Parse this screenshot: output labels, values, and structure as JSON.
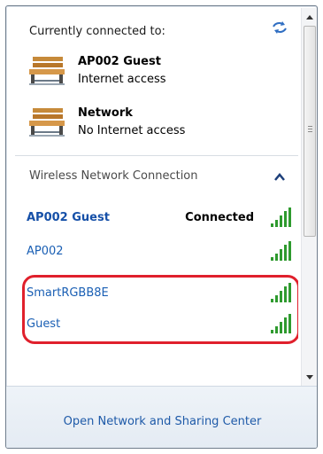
{
  "header": {
    "title": "Currently connected to:",
    "refresh_icon": "refresh-network-icon"
  },
  "connections": [
    {
      "name": "AP002 Guest",
      "status": "Internet access",
      "icon": "bench-network-icon"
    },
    {
      "name": "Network",
      "status": "No Internet access",
      "icon": "bench-network-icon"
    }
  ],
  "wireless": {
    "section_title": "Wireless Network Connection",
    "collapse_icon": "chevron-up-icon",
    "networks": [
      {
        "name": "AP002 Guest",
        "status": "Connected",
        "signal": "signal-bars-icon"
      },
      {
        "name": "AP002",
        "status": "",
        "signal": "signal-bars-icon"
      },
      {
        "name": "SmartRGBB8E",
        "status": "",
        "signal": "signal-bars-icon"
      },
      {
        "name": "Guest",
        "status": "",
        "signal": "signal-bars-icon"
      }
    ]
  },
  "footer": {
    "link": "Open Network and Sharing Center"
  },
  "colors": {
    "link_blue": "#1a5fb4",
    "highlight_red": "#e0202c",
    "signal_green": "#2e9a2e"
  }
}
